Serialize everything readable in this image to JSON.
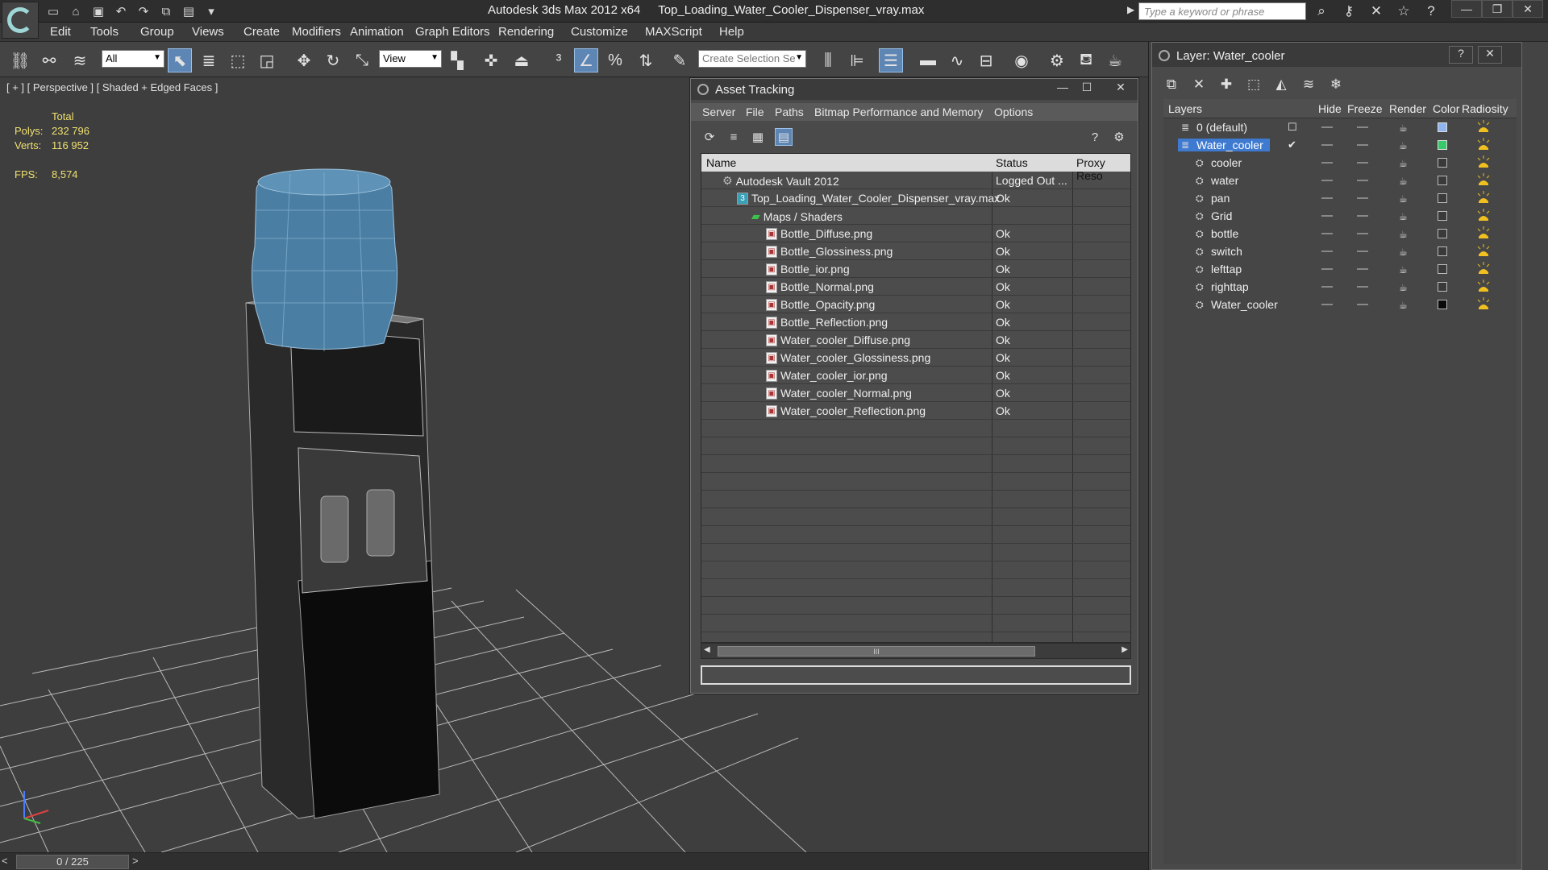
{
  "titlebar": {
    "app_title": "Autodesk 3ds Max  2012 x64",
    "file_name": "Top_Loading_Water_Cooler_Dispenser_vray.max",
    "search_placeholder": "Type a keyword or phrase",
    "quick_access_icons": [
      "new-file-icon",
      "open-file-icon",
      "save-icon",
      "undo-icon",
      "redo-icon",
      "project-icon",
      "window-icon",
      "dropdown-icon"
    ],
    "right_icons": [
      "binoculars-icon",
      "key-icon",
      "subscription-icon",
      "star-icon",
      "help-icon"
    ]
  },
  "menubar": [
    "Edit",
    "Tools",
    "Group",
    "Views",
    "Create",
    "Modifiers",
    "Animation",
    "Graph Editors",
    "Rendering",
    "Customize",
    "MAXScript",
    "Help"
  ],
  "toolbar": {
    "filter_value": "All",
    "reference_coord_value": "View",
    "selection_set_placeholder": "Create Selection Se"
  },
  "viewport": {
    "label": "[ + ] [ Perspective ] [ Shaded + Edged Faces ]",
    "stats_header": "Total",
    "stats": [
      {
        "key": "Polys:",
        "value": "232 796"
      },
      {
        "key": "Verts:",
        "value": "116 952"
      }
    ],
    "fps_key": "FPS:",
    "fps_value": "8,574"
  },
  "timeline": {
    "frame_text": "0 / 225",
    "prev": "<",
    "next": ">"
  },
  "asset_tracking": {
    "title": "Asset Tracking",
    "menu": [
      "Server",
      "File",
      "Paths",
      "Bitmap Performance and Memory",
      "Options"
    ],
    "columns": [
      "Name",
      "Status",
      "Proxy Reso"
    ],
    "rows": [
      {
        "name": "Autodesk Vault 2012",
        "status": "Logged Out ...",
        "indent": 0,
        "kind": "vault"
      },
      {
        "name": "Top_Loading_Water_Cooler_Dispenser_vray.max",
        "status": "Ok",
        "indent": 1,
        "kind": "max"
      },
      {
        "name": "Maps / Shaders",
        "status": "",
        "indent": 2,
        "kind": "folder"
      },
      {
        "name": "Bottle_Diffuse.png",
        "status": "Ok",
        "indent": 3,
        "kind": "file"
      },
      {
        "name": "Bottle_Glossiness.png",
        "status": "Ok",
        "indent": 3,
        "kind": "file"
      },
      {
        "name": "Bottle_ior.png",
        "status": "Ok",
        "indent": 3,
        "kind": "file"
      },
      {
        "name": "Bottle_Normal.png",
        "status": "Ok",
        "indent": 3,
        "kind": "file"
      },
      {
        "name": "Bottle_Opacity.png",
        "status": "Ok",
        "indent": 3,
        "kind": "file"
      },
      {
        "name": "Bottle_Reflection.png",
        "status": "Ok",
        "indent": 3,
        "kind": "file"
      },
      {
        "name": "Water_cooler_Diffuse.png",
        "status": "Ok",
        "indent": 3,
        "kind": "file"
      },
      {
        "name": "Water_cooler_Glossiness.png",
        "status": "Ok",
        "indent": 3,
        "kind": "file"
      },
      {
        "name": "Water_cooler_ior.png",
        "status": "Ok",
        "indent": 3,
        "kind": "file"
      },
      {
        "name": "Water_cooler_Normal.png",
        "status": "Ok",
        "indent": 3,
        "kind": "file"
      },
      {
        "name": "Water_cooler_Reflection.png",
        "status": "Ok",
        "indent": 3,
        "kind": "file"
      }
    ],
    "scroll_thumb_label": "III"
  },
  "layer_panel": {
    "title": "Layer: Water_cooler",
    "columns": [
      "Layers",
      "Hide",
      "Freeze",
      "Render",
      "Color",
      "Radiosity"
    ],
    "layers": [
      {
        "name": "0 (default)",
        "level": 0,
        "selected": false,
        "color": "#8fb4f0",
        "active_mark": "box"
      },
      {
        "name": "Water_cooler",
        "level": 0,
        "selected": true,
        "color": "#39c86a",
        "active_mark": "check"
      },
      {
        "name": "cooler",
        "level": 1,
        "selected": false,
        "color": "#3a3a3a"
      },
      {
        "name": "water",
        "level": 1,
        "selected": false,
        "color": "#3a3a3a"
      },
      {
        "name": "pan",
        "level": 1,
        "selected": false,
        "color": "#3a3a3a"
      },
      {
        "name": "Grid",
        "level": 1,
        "selected": false,
        "color": "#3a3a3a"
      },
      {
        "name": "bottle",
        "level": 1,
        "selected": false,
        "color": "#3a3a3a"
      },
      {
        "name": "switch",
        "level": 1,
        "selected": false,
        "color": "#3a3a3a"
      },
      {
        "name": "lefttap",
        "level": 1,
        "selected": false,
        "color": "#3a3a3a"
      },
      {
        "name": "righttap",
        "level": 1,
        "selected": false,
        "color": "#3a3a3a"
      },
      {
        "name": "Water_cooler",
        "level": 1,
        "selected": false,
        "color": "#0a0a0a"
      }
    ]
  },
  "colors": {
    "stats_text": "#f0e070",
    "selection_blue": "#3f7ad1",
    "button_active": "#5d86b5"
  }
}
